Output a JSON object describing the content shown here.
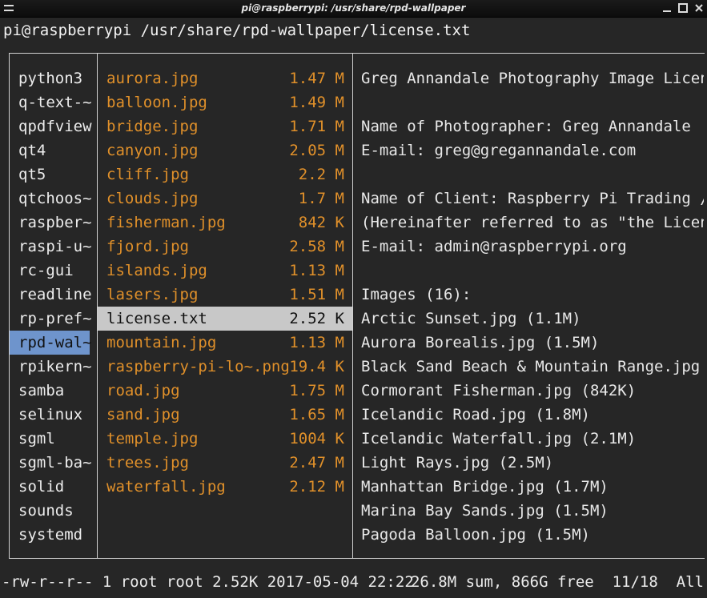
{
  "window": {
    "title": "pi@raspberrypi: /usr/share/rpd-wallpaper"
  },
  "header": {
    "path": "pi@raspberrypi /usr/share/rpd-wallpaper/license.txt"
  },
  "parent_dirs": [
    {
      "name": "python3"
    },
    {
      "name": "q-text-~"
    },
    {
      "name": "qpdfview"
    },
    {
      "name": "qt4"
    },
    {
      "name": "qt5"
    },
    {
      "name": "qtchoos~"
    },
    {
      "name": "raspber~"
    },
    {
      "name": "raspi-u~"
    },
    {
      "name": "rc-gui"
    },
    {
      "name": "readline"
    },
    {
      "name": "rp-pref~"
    },
    {
      "name": "rpd-wal~",
      "selected": true
    },
    {
      "name": "rpikern~"
    },
    {
      "name": "samba"
    },
    {
      "name": "selinux"
    },
    {
      "name": "sgml"
    },
    {
      "name": "sgml-ba~"
    },
    {
      "name": "solid"
    },
    {
      "name": "sounds"
    },
    {
      "name": "systemd"
    }
  ],
  "files": [
    {
      "name": "aurora.jpg",
      "size": "1.47 M"
    },
    {
      "name": "balloon.jpg",
      "size": "1.49 M"
    },
    {
      "name": "bridge.jpg",
      "size": "1.71 M"
    },
    {
      "name": "canyon.jpg",
      "size": "2.05 M"
    },
    {
      "name": "cliff.jpg",
      "size": "2.2 M"
    },
    {
      "name": "clouds.jpg",
      "size": "1.7 M"
    },
    {
      "name": "fisherman.jpg",
      "size": "842 K"
    },
    {
      "name": "fjord.jpg",
      "size": "2.58 M"
    },
    {
      "name": "islands.jpg",
      "size": "1.13 M"
    },
    {
      "name": "lasers.jpg",
      "size": "1.51 M"
    },
    {
      "name": "license.txt",
      "size": "2.52 K",
      "current": true
    },
    {
      "name": "mountain.jpg",
      "size": "1.13 M"
    },
    {
      "name": "raspberry-pi-lo~.png",
      "size": "19.4 K"
    },
    {
      "name": "road.jpg",
      "size": "1.75 M"
    },
    {
      "name": "sand.jpg",
      "size": "1.65 M"
    },
    {
      "name": "temple.jpg",
      "size": "1004 K"
    },
    {
      "name": "trees.jpg",
      "size": "2.47 M"
    },
    {
      "name": "waterfall.jpg",
      "size": "2.12 M"
    }
  ],
  "preview_lines": [
    "Greg Annandale Photography Image Licen",
    "",
    "Name of Photographer: Greg Annandale",
    "E-mail: greg@gregannandale.com",
    "",
    "Name of Client: Raspberry Pi Trading /",
    "(Hereinafter referred to as \"the Licen",
    "E-mail: admin@raspberrypi.org",
    "",
    "Images (16):",
    "Arctic Sunset.jpg (1.1M)",
    "Aurora Borealis.jpg (1.5M)",
    "Black Sand Beach & Mountain Range.jpg",
    "Cormorant Fisherman.jpg (842K)",
    "Icelandic Road.jpg (1.8M)",
    "Icelandic Waterfall.jpg (2.1M)",
    "Light Rays.jpg (2.5M)",
    "Manhattan Bridge.jpg (1.7M)",
    "Marina Bay Sands.jpg (1.5M)",
    "Pagoda Balloon.jpg (1.5M)"
  ],
  "status": {
    "left": "-rw-r--r-- 1 root root 2.52K 2017-05-04 22:22",
    "right": "26.8M sum, 866G free  11/18  All"
  },
  "colors": {
    "background": "#262626",
    "file_color": "#e0902a",
    "selected_dir_bg": "#6e94cc",
    "current_file_bg": "#c8c8c8"
  }
}
